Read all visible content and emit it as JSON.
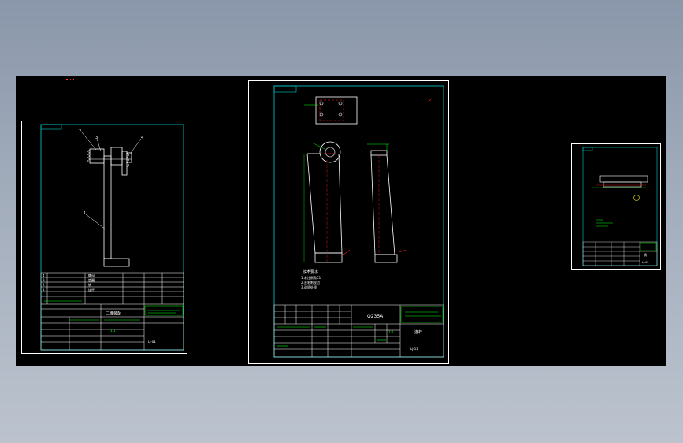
{
  "app": {
    "canvas_bg": "#000000",
    "line_colors": {
      "frame": "#ffffff",
      "border": "#00d0d0",
      "part": "#ffffff",
      "table": "#ffffff",
      "label": "#00ff00",
      "red": "#ff2020",
      "yellow": "#ffff00"
    }
  },
  "sheets": {
    "assembly": {
      "title": "二维装配",
      "drawing_no": "LJ-01",
      "scale": "1:1",
      "parts": [
        {
          "no": "4",
          "name": "螺母"
        },
        {
          "no": "3",
          "name": "垫圈"
        },
        {
          "no": "2",
          "name": "销"
        },
        {
          "no": "1",
          "name": "连杆"
        }
      ],
      "balloons": [
        "2",
        "3",
        "4",
        "1"
      ]
    },
    "part": {
      "material": "Q235A",
      "title": "连杆",
      "drawing_no": "LJ-11",
      "scale": "1:1",
      "notes_heading": "技术要求",
      "notes": [
        "1.未注倒角C1",
        "2.去毛刺锐边",
        "3.调质处理"
      ]
    },
    "small": {
      "title": "销",
      "drawing_no": "LJ-02"
    }
  }
}
